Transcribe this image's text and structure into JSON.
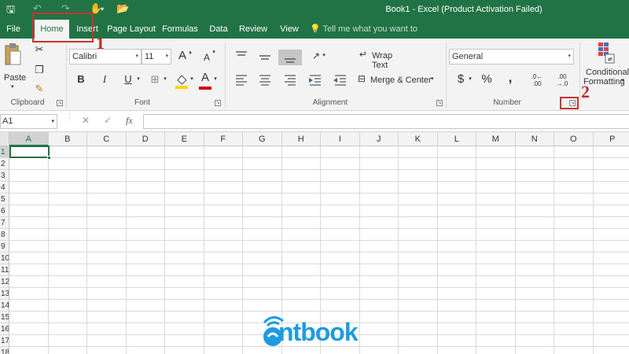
{
  "window": {
    "title": "Book1 - Excel (Product Activation Failed)"
  },
  "quick_access": {
    "save_icon": "save-icon",
    "undo_icon": "undo-icon",
    "redo_icon": "redo-icon",
    "touch_icon": "touch-mode-icon",
    "open_icon": "open-folder-icon"
  },
  "tabs": [
    "File",
    "Home",
    "Insert",
    "Page Layout",
    "Formulas",
    "Data",
    "Review",
    "View"
  ],
  "tell_me": {
    "placeholder": "Tell me what you want to do..."
  },
  "clipboard": {
    "paste_label": "Paste",
    "group_label": "Clipboard"
  },
  "font": {
    "name": "Calibri",
    "size": "11",
    "bold": "B",
    "italic": "I",
    "underline": "U",
    "grow": "A",
    "shrink": "A",
    "color_letter": "A",
    "group_label": "Font",
    "fill_color": "#ffd500",
    "font_color": "#d00000"
  },
  "alignment": {
    "wrap_text": "Wrap Text",
    "merge_center": "Merge & Center",
    "group_label": "Alignment"
  },
  "number": {
    "format": "General",
    "currency": "$",
    "percent": "%",
    "comma": ",",
    "inc_decimal": ".0← .00",
    "dec_decimal": ".00 →.0",
    "group_label": "Number"
  },
  "styles": {
    "conditional_line1": "Conditional",
    "conditional_line2": "Formatting"
  },
  "formula_bar": {
    "name_box": "A1",
    "cancel": "✕",
    "enter": "✓",
    "fx": "fx",
    "value": ""
  },
  "grid": {
    "columns": [
      "A",
      "B",
      "C",
      "D",
      "E",
      "F",
      "G",
      "H",
      "I",
      "J",
      "K",
      "L",
      "M",
      "N",
      "O",
      "P"
    ],
    "rows": [
      "1",
      "2",
      "3",
      "4",
      "5",
      "6",
      "7",
      "8",
      "9",
      "10",
      "11",
      "12",
      "13",
      "14",
      "15",
      "16",
      "17",
      "18"
    ],
    "active_cell": "A1"
  },
  "annotations": {
    "step1": "1",
    "step2": "2",
    "color": "#d03030"
  },
  "watermark": {
    "text": "ntbook",
    "color": "#1e9be0"
  },
  "colors": {
    "excel_green": "#217346",
    "ribbon_bg": "#f3f3f3"
  }
}
